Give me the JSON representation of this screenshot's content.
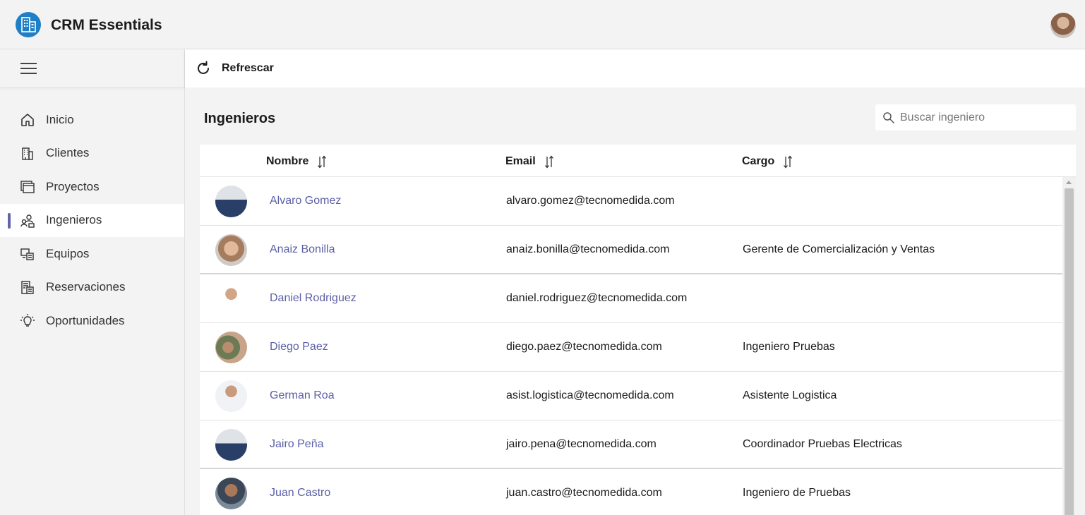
{
  "app": {
    "title": "CRM Essentials"
  },
  "colors": {
    "accent": "#6264a7",
    "link": "#5b5fa7",
    "logo": "#1e7fc7"
  },
  "sidebar": {
    "items": [
      {
        "label": "Inicio",
        "icon": "home-icon",
        "active": false
      },
      {
        "label": "Clientes",
        "icon": "building-icon",
        "active": false
      },
      {
        "label": "Proyectos",
        "icon": "folders-icon",
        "active": false
      },
      {
        "label": "Ingenieros",
        "icon": "people-icon",
        "active": true
      },
      {
        "label": "Equipos",
        "icon": "devices-icon",
        "active": false
      },
      {
        "label": "Reservaciones",
        "icon": "calendar-doc-icon",
        "active": false
      },
      {
        "label": "Oportunidades",
        "icon": "lightbulb-icon",
        "active": false
      }
    ]
  },
  "toolbar": {
    "refresh_label": "Refrescar"
  },
  "main": {
    "title": "Ingenieros",
    "search": {
      "placeholder": "Buscar ingeniero",
      "value": ""
    },
    "columns": {
      "name": "Nombre",
      "email": "Email",
      "role": "Cargo"
    },
    "rows": [
      {
        "name": "Alvaro Gomez",
        "email": "alvaro.gomez@tecnomedida.com",
        "role": ""
      },
      {
        "name": "Anaiz Bonilla",
        "email": "anaiz.bonilla@tecnomedida.com",
        "role": "Gerente de Comercialización y Ventas"
      },
      {
        "name": "Daniel Rodriguez",
        "email": "daniel.rodriguez@tecnomedida.com",
        "role": ""
      },
      {
        "name": "Diego Paez",
        "email": "diego.paez@tecnomedida.com",
        "role": "Ingeniero Pruebas"
      },
      {
        "name": "German Roa",
        "email": "asist.logistica@tecnomedida.com",
        "role": "Asistente Logistica"
      },
      {
        "name": "Jairo Peña",
        "email": "jairo.pena@tecnomedida.com",
        "role": "Coordinador Pruebas Electricas"
      },
      {
        "name": "Juan Castro",
        "email": "juan.castro@tecnomedida.com",
        "role": "Ingeniero de Pruebas"
      }
    ]
  }
}
